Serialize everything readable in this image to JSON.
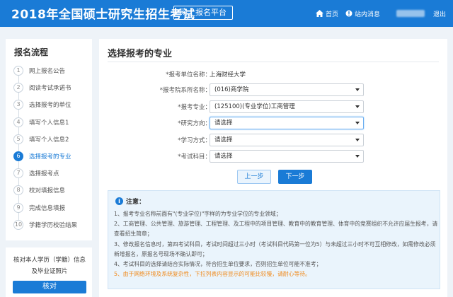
{
  "header": {
    "title": "2018年全国硕士研究生招生考试",
    "badge": "网上报名平台",
    "home_label": "首页",
    "messages_label": "站内消息",
    "logout_label": "退出"
  },
  "sidebar": {
    "title": "报名流程",
    "steps": [
      {
        "num": "1",
        "label": "网上报名公告"
      },
      {
        "num": "2",
        "label": "阅读考试承诺书"
      },
      {
        "num": "3",
        "label": "选择报考的单位"
      },
      {
        "num": "4",
        "label": "填写个人信息1"
      },
      {
        "num": "5",
        "label": "填写个人信息2"
      },
      {
        "num": "6",
        "label": "选择报考的专业"
      },
      {
        "num": "7",
        "label": "选择报考点"
      },
      {
        "num": "8",
        "label": "校对填报信息"
      },
      {
        "num": "9",
        "label": "完成信息填报"
      },
      {
        "num": "10",
        "label": "学籍学历校验结果"
      }
    ],
    "active_step": 6,
    "verify_text": "核对本人学历（学籍）信息及毕业证照片",
    "verify_button": "核对"
  },
  "main": {
    "title": "选择报考的专业",
    "fields": {
      "unit_label": "*报考单位名称：",
      "unit_value": "上海财经大学",
      "dept_label": "*报考院系所名称：",
      "dept_value": "(016)商学院",
      "major_label": "*报考专业：",
      "major_value": "(125100)(专业学位)工商管理",
      "direction_label": "*研究方向：",
      "direction_value": "请选择",
      "mode_label": "*学习方式：",
      "mode_value": "请选择",
      "subject_label": "*考试科目：",
      "subject_value": "请选择"
    },
    "prev_button": "上一步",
    "next_button": "下一步",
    "notice": {
      "title": "注意：",
      "items": [
        "1、报考专业名称前面有\"(专业学位)\"字样的为专业学位的专业领域；",
        "2、工商管理、公共管理、旅游管理、工程管理、及工程中的项目管理、教育中的教育管理、体育中的竞赛组织不允许应届生报考，请查看招生简章；",
        "3、修改报名信息时，第四考试科目，考试时间超过三小时（考试科目代码第一位为5）与未超过三小时不可互相修改，如需修改必须新增报名，原报名号现场不确认即可；",
        "4、考试科目的选择请结合实际情况，符合招生单位要求，否则招生单位可能不准考；",
        "5、由于网络环境及系统复杂性，下拉列表内容显示的可能比较慢，请耐心等待。"
      ]
    }
  },
  "colors": {
    "primary": "#1a7bd6",
    "warning": "#f08a1c",
    "notice_bg": "#eaf4fc"
  }
}
